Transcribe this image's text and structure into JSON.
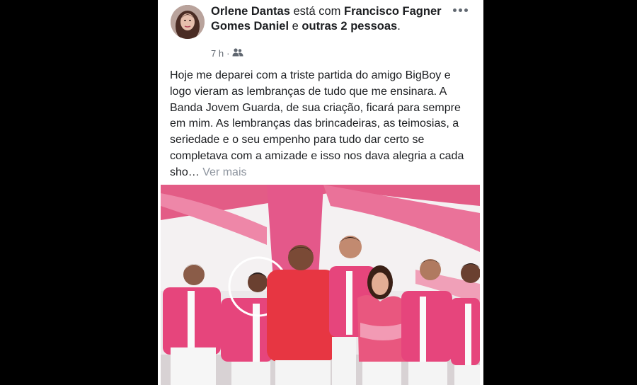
{
  "post": {
    "author": "Orlene Dantas",
    "with_text": "está com",
    "tagged": "Francisco Fagner Gomes Daniel",
    "and_text": "e",
    "others": "outras 2 pessoas",
    "period": ".",
    "time": "7 h",
    "separator": "·",
    "audience_icon": "friends-icon",
    "more_icon": "more-options-icon",
    "body": "Hoje me deparei com a triste partida do amigo BigBoy e logo vieram as lembranças de tudo que me ensinara. A Banda Jovem Guarda, de sua criação, ficará para sempre em mim. As lembranças das brincadeiras, as teimosias, a seriedade e o seu empenho para tudo dar certo se completava com a amizade e isso nos dava alegria a cada sho…",
    "see_more": "Ver mais"
  },
  "colors": {
    "background": "#000000",
    "card": "#ffffff",
    "text": "#1c1e21",
    "secondary": "#606770",
    "see_more": "#8d949e",
    "drape_pink": "#e0507e",
    "shirt_pink": "#e8407a"
  }
}
